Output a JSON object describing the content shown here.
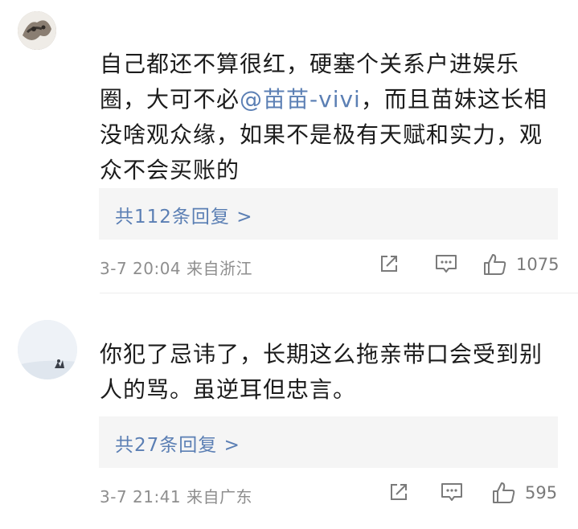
{
  "comments": [
    {
      "text_before": "自己都还不算很红，硬塞个关系户进娱乐圈，大可不必",
      "mention": "@苗苗-vivi",
      "text_after": "，而且苗妹这长相没啥观众缘，如果不是极有天赋和实力，观众不会买账的",
      "replies_label": "共112条回复 >",
      "date_time": "3-7 20:04",
      "location": "来自浙江",
      "like_count": "1075",
      "icons": [
        "share-icon",
        "comment-icon",
        "like-icon"
      ]
    },
    {
      "text": "你犯了忌讳了，长期这么拖亲带口会受到别人的骂。虽逆耳但忠言。",
      "replies_label": "共27条回复 >",
      "date_time": "3-7 21:41",
      "location": "来自广东",
      "like_count": "595",
      "icons": [
        "share-icon",
        "comment-icon",
        "like-icon"
      ]
    }
  ],
  "colors": {
    "link": "#5b7fb4",
    "text": "#1c1c1c",
    "meta": "#8e8e8e",
    "reply_bg": "#f5f5f5"
  }
}
